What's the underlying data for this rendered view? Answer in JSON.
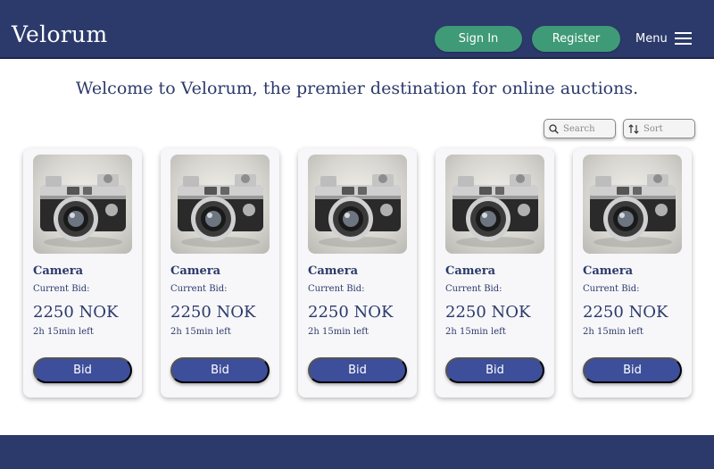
{
  "header": {
    "logo": "Velorum",
    "signin_label": "Sign In",
    "register_label": "Register",
    "menu_label": "Menu"
  },
  "welcome": "Welcome to Velorum, the premier destination for online auctions.",
  "toolbar": {
    "search_placeholder": "Search",
    "sort_label": "Sort"
  },
  "colors": {
    "header_bg": "#2c3a6b",
    "accent_green": "#3f9a78",
    "bid_button": "#3d4e9a",
    "text_primary": "#2c3a6b"
  },
  "items": [
    {
      "title": "Camera",
      "bid_label": "Current Bid:",
      "price": "2250 NOK",
      "time_left": "2h 15min left",
      "bid_button": "Bid",
      "image_icon": "camera-image"
    },
    {
      "title": "Camera",
      "bid_label": "Current Bid:",
      "price": "2250 NOK",
      "time_left": "2h 15min left",
      "bid_button": "Bid",
      "image_icon": "camera-image"
    },
    {
      "title": "Camera",
      "bid_label": "Current Bid:",
      "price": "2250 NOK",
      "time_left": "2h 15min left",
      "bid_button": "Bid",
      "image_icon": "camera-image"
    },
    {
      "title": "Camera",
      "bid_label": "Current Bid:",
      "price": "2250 NOK",
      "time_left": "2h 15min left",
      "bid_button": "Bid",
      "image_icon": "camera-image"
    },
    {
      "title": "Camera",
      "bid_label": "Current Bid:",
      "price": "2250 NOK",
      "time_left": "2h 15min left",
      "bid_button": "Bid",
      "image_icon": "camera-image"
    }
  ]
}
